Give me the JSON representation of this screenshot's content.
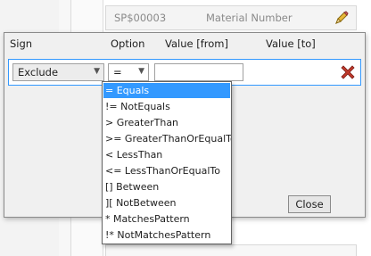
{
  "background": {
    "row_id": "SP$00003",
    "row_label": "Material Number"
  },
  "dialog": {
    "headers": {
      "sign": "Sign",
      "option": "Option",
      "value_from": "Value [from]",
      "value_to": "Value [to]"
    },
    "row": {
      "sign_value": "Exclude",
      "option_value": "=",
      "value_from": "",
      "delete_icon": "red-x-icon"
    },
    "close_label": "Close"
  },
  "dropdown": {
    "selected_index": 0,
    "options": [
      "=  Equals",
      "!= NotEquals",
      ">  GreaterThan",
      ">= GreaterThanOrEqualTo",
      "<  LessThan",
      "<= LessThanOrEqualTo",
      "[] Between",
      "][ NotBetween",
      "*  MatchesPattern",
      "!* NotMatchesPattern"
    ]
  },
  "colors": {
    "selection": "#3399ff",
    "delete_red": "#c0392b"
  }
}
